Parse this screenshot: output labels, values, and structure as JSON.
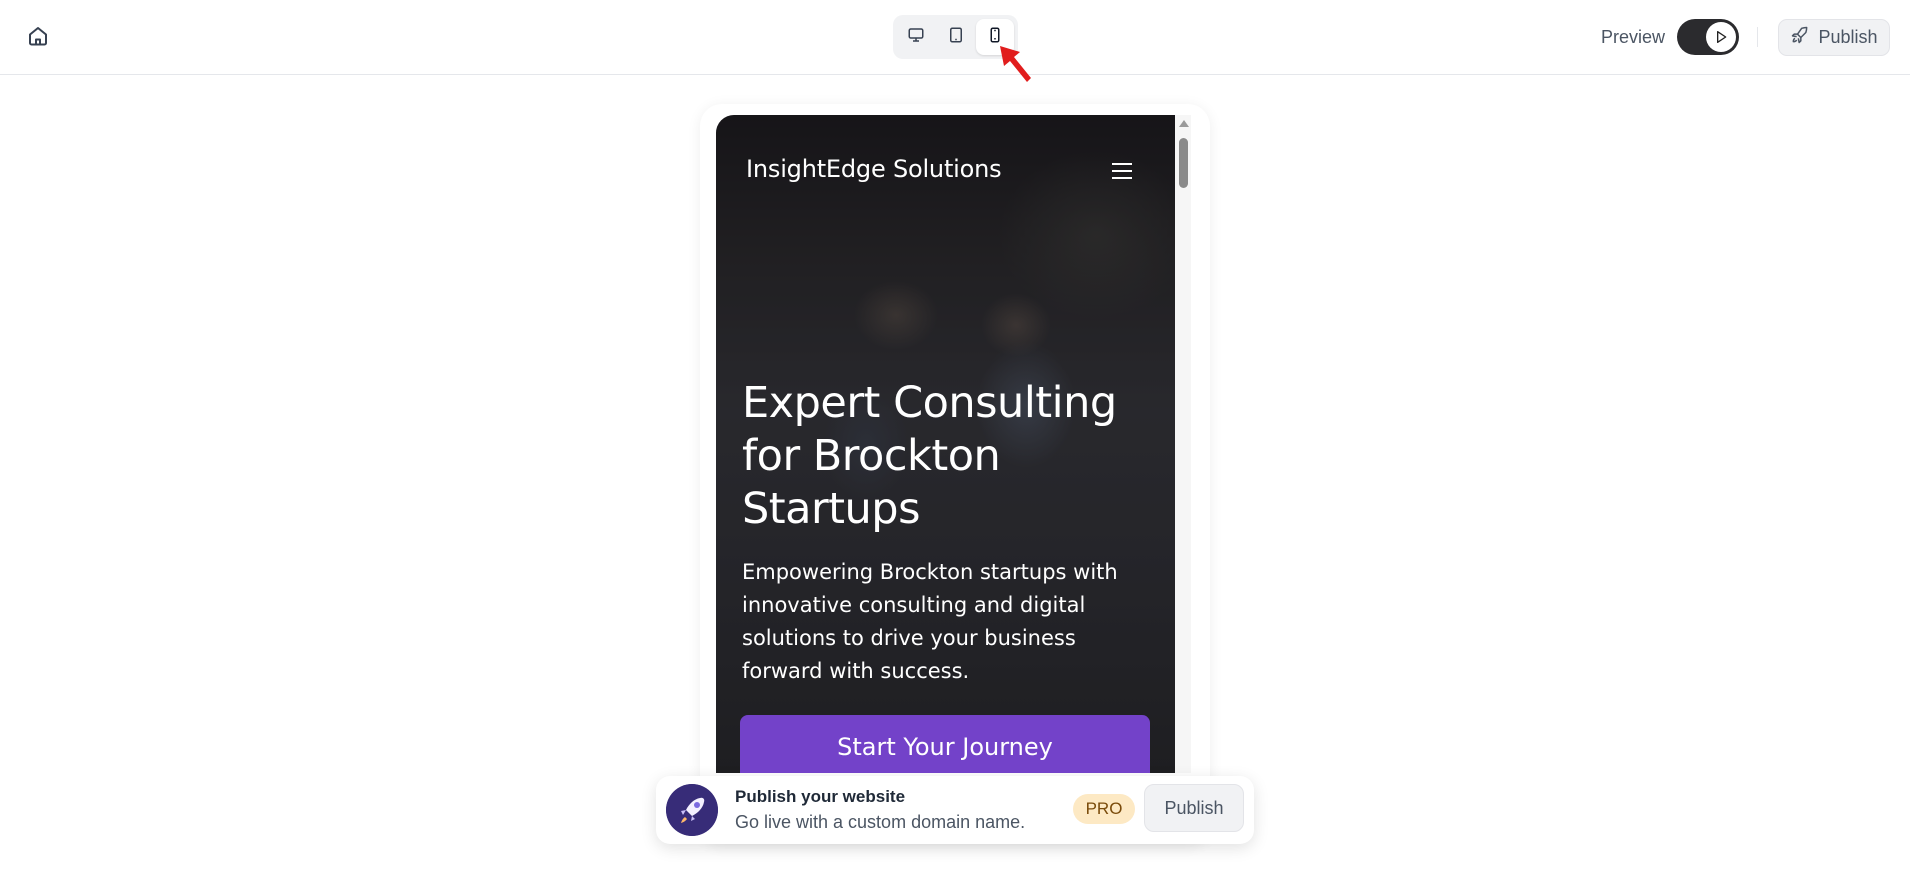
{
  "topbar": {
    "home_icon": "home-icon",
    "device_modes": [
      {
        "name": "desktop",
        "icon": "monitor-icon",
        "active": false
      },
      {
        "name": "tablet",
        "icon": "tablet-icon",
        "active": false
      },
      {
        "name": "mobile",
        "icon": "smartphone-icon",
        "active": true
      }
    ],
    "preview_label": "Preview",
    "preview_toggle_on": true,
    "publish_label": "Publish",
    "publish_icon": "rocket-icon"
  },
  "site": {
    "brand": "InsightEdge Solutions",
    "menu_icon": "hamburger-icon",
    "hero_title": "Expert Consulting for Brockton Startups",
    "hero_description": "Empowering Brockton startups with innovative consulting and digital solutions to drive your business forward with success.",
    "cta_label": "Start Your Journey",
    "accent_color": "#7342c9"
  },
  "banner": {
    "title": "Publish your website",
    "subtitle": "Go live with a custom domain name.",
    "badge": "PRO",
    "button_label": "Publish",
    "logo_icon": "rocket-logo-icon"
  }
}
